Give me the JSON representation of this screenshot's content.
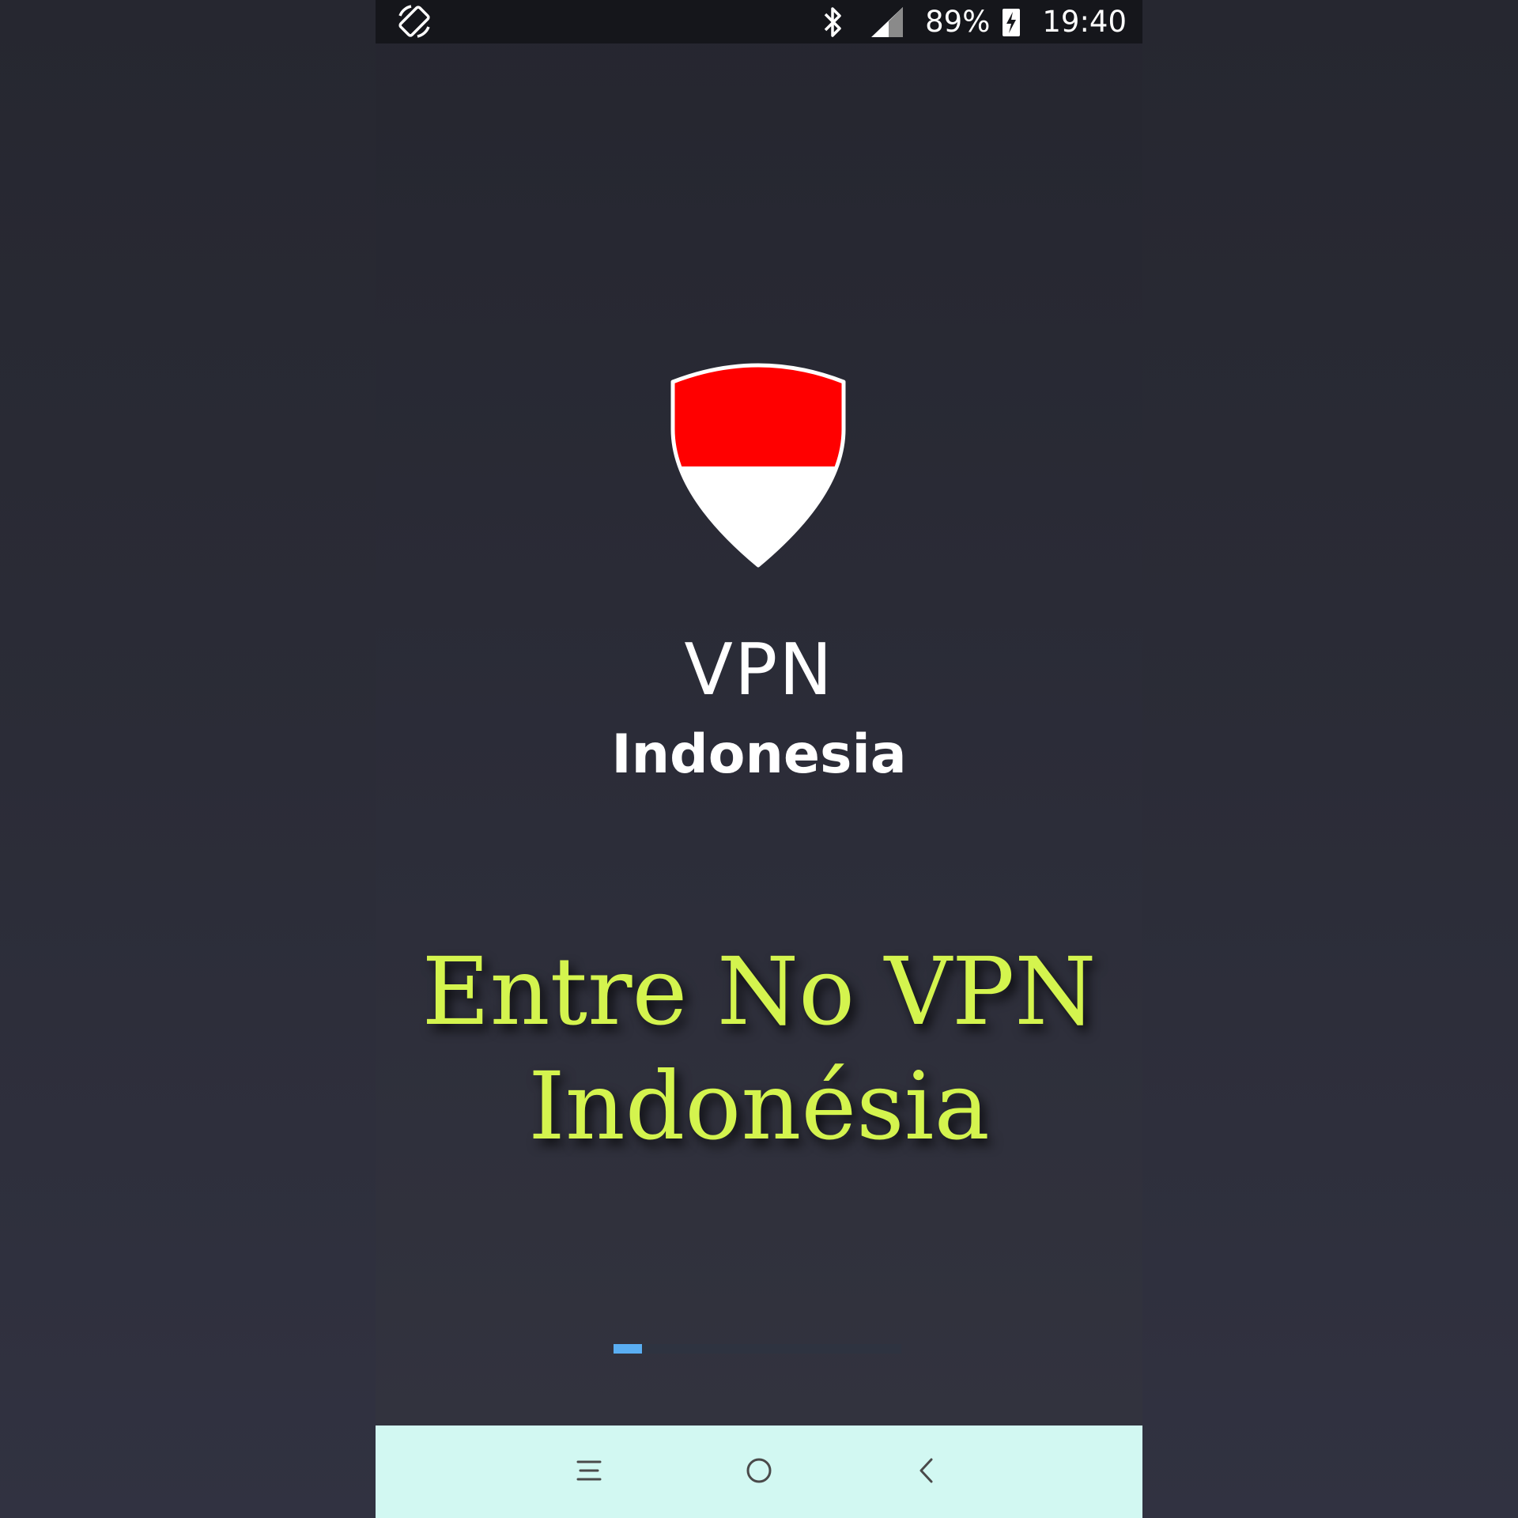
{
  "status_bar": {
    "battery": "89%",
    "time": "19:40",
    "icons": [
      "screen-rotate-icon",
      "bluetooth-icon",
      "signal-icon",
      "battery-charging-icon"
    ]
  },
  "splash": {
    "logo_icon": "indonesia-flag-shield-icon",
    "app_name_line1": "VPN",
    "app_name_line2": "Indonesia",
    "colors": {
      "flag_red": "#ff0000",
      "flag_white": "#ffffff",
      "caption": "#d4f44e",
      "progress": "#5aaef2"
    }
  },
  "caption": {
    "line1": "Entre No VPN",
    "line2": "Indonésia"
  },
  "loading": {
    "progress": 0.1
  },
  "nav_bar": {
    "icons": [
      "menu-icon",
      "home-icon",
      "back-icon"
    ]
  }
}
